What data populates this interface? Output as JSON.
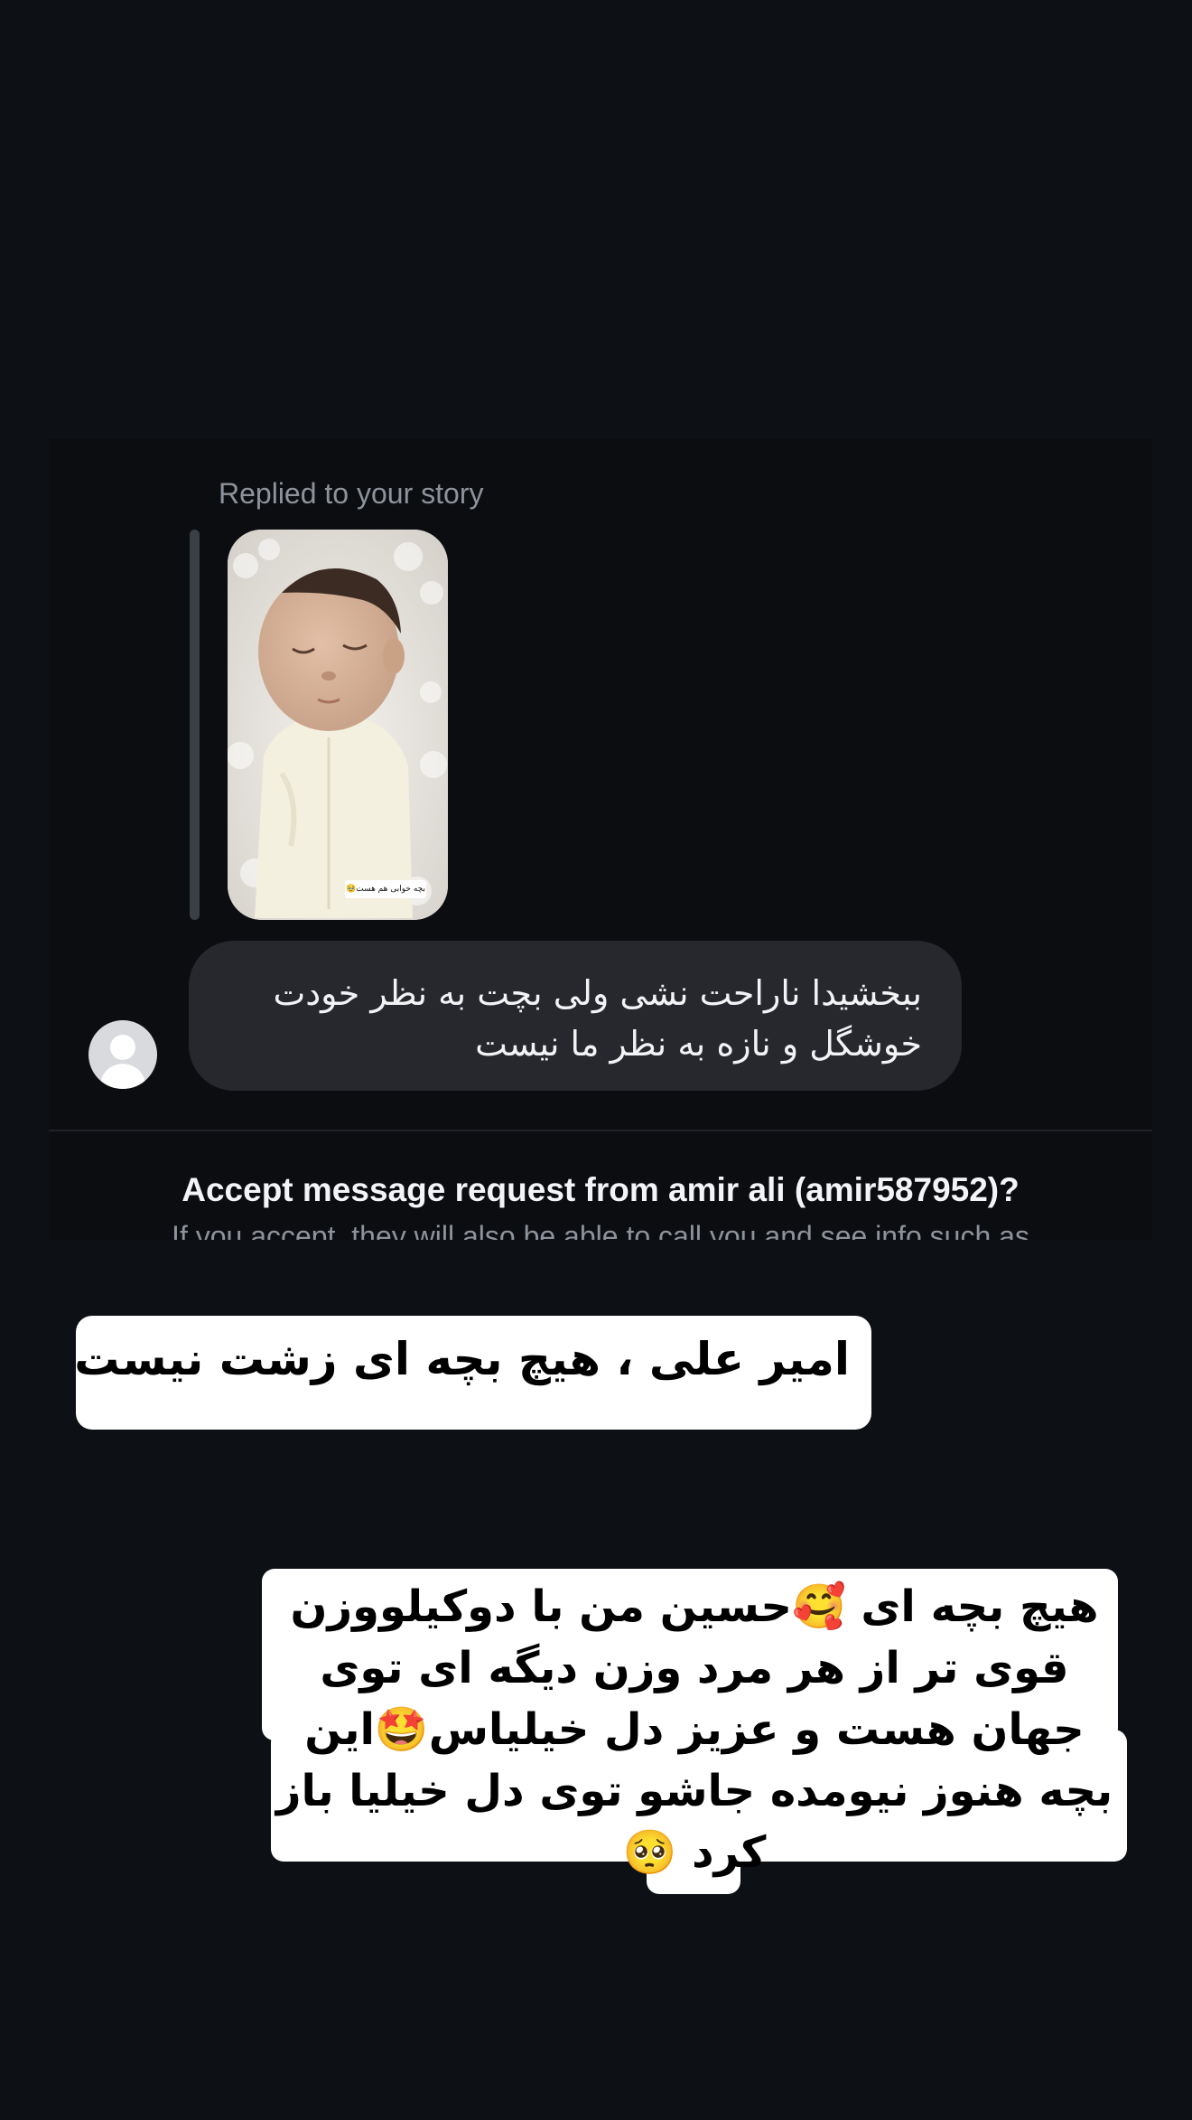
{
  "thread": {
    "story_reply_label": "Replied to your story",
    "story_caption": "بچه خوابی هم هست🥹",
    "message_text": "ببخشیدا ناراحت نشی ولی بچت به نظر خودت خوشگل و نازه به نظر ما نیست",
    "request_prompt": "Accept message request from amir ali (amir587952)?",
    "request_subtitle": "If you accept, they will also be able to call you and see info such as"
  },
  "overlay": {
    "sticker_top_text": "امیر علی ، هیچ بچه ای زشت نیست",
    "sticker_bottom_text": "هیچ بچه ای 🥰حسین من با دوکیلووزن قوی تر از هر مرد وزن دیگه ای توی جهان هست و  عزیز دل خیلیاس🤩این بچه هنوز نیومده جاشو توی دل خیلیا باز کرد 🥺"
  },
  "colors": {
    "background": "#0d1015",
    "bubble": "#26282d",
    "muted_text": "#8e939b",
    "sticker": "#ffffff"
  }
}
